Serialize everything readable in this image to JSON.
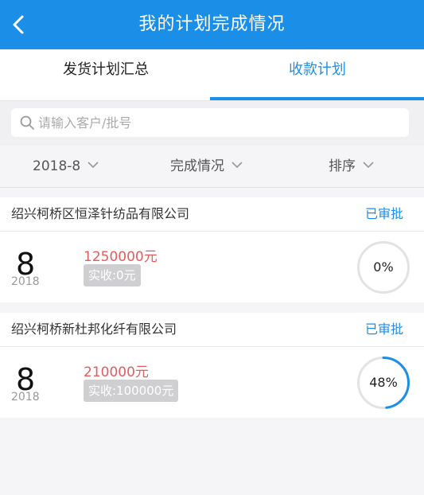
{
  "header": {
    "title": "我的计划完成情况",
    "color": "#1b8fe8"
  },
  "tabs": [
    {
      "label": "发货计划汇总",
      "active": false
    },
    {
      "label": "收款计划",
      "active": true
    }
  ],
  "search": {
    "placeholder": "请输入客户/批号",
    "value": ""
  },
  "filters": {
    "month": "2018-8",
    "completion": "完成情况",
    "sort": "排序"
  },
  "plans": [
    {
      "company": "绍兴柯桥区恒泽针纺品有限公司",
      "status": "已审批",
      "day": "8",
      "year": "2018",
      "amount": "1250000元",
      "received": "实收:0元",
      "percent": 0,
      "percent_label": "0%"
    },
    {
      "company": "绍兴柯桥新杜邦化纤有限公司",
      "status": "已审批",
      "day": "8",
      "year": "2018",
      "amount": "210000元",
      "received": "实收:100000元",
      "percent": 48,
      "percent_label": "48%"
    }
  ],
  "colors": {
    "accent": "#1b8fe8",
    "amount": "#e25c5c",
    "badge": "#cfcfd2"
  }
}
